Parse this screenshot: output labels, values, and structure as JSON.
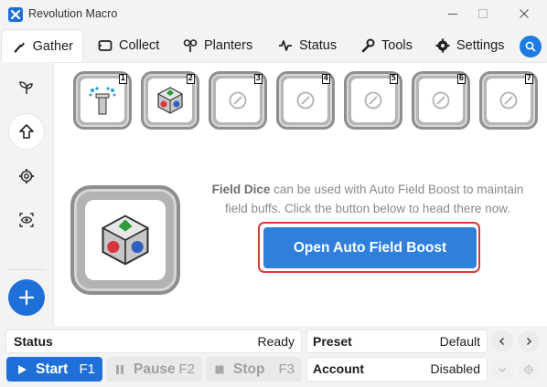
{
  "window": {
    "title": "Revolution Macro",
    "controls": [
      "minimize-icon",
      "maximize-icon",
      "close-icon"
    ]
  },
  "tabs": [
    {
      "label": "Gather",
      "icon": "gather-icon",
      "active": true
    },
    {
      "label": "Collect",
      "icon": "ticket-icon",
      "active": false
    },
    {
      "label": "Planters",
      "icon": "sprout-icon",
      "active": false
    },
    {
      "label": "Status",
      "icon": "pulse-icon",
      "active": false
    },
    {
      "label": "Tools",
      "icon": "wrench-icon",
      "active": false
    },
    {
      "label": "Settings",
      "icon": "gear-icon",
      "active": false
    }
  ],
  "sidebar": {
    "items": [
      {
        "icon": "sprout-icon",
        "active": false
      },
      {
        "icon": "arrow-up-icon",
        "active": true
      },
      {
        "icon": "gear-icon",
        "active": false
      },
      {
        "icon": "eye-scan-icon",
        "active": false
      }
    ],
    "add_icon": "plus-icon"
  },
  "slots": [
    {
      "number": "1",
      "icon": "sprinkler-icon"
    },
    {
      "number": "2",
      "icon": "field-dice-icon"
    },
    {
      "number": "3",
      "icon": "empty-slot-icon"
    },
    {
      "number": "4",
      "icon": "empty-slot-icon"
    },
    {
      "number": "5",
      "icon": "empty-slot-icon"
    },
    {
      "number": "6",
      "icon": "empty-slot-icon"
    },
    {
      "number": "7",
      "icon": "empty-slot-icon"
    }
  ],
  "main": {
    "selected_item_icon": "field-dice-icon",
    "desc_highlight": "Field Dice",
    "desc_rest": " can be used with Auto Field Boost to maintain field buffs. Click the button below to head there now.",
    "boost_button": "Open Auto Field Boost"
  },
  "status": {
    "label": "Status",
    "value": "Ready"
  },
  "preset": {
    "label": "Preset",
    "value": "Default"
  },
  "account": {
    "label": "Account",
    "value": "Disabled"
  },
  "controls": {
    "start": {
      "label": "Start",
      "key": "F1"
    },
    "pause": {
      "label": "Pause",
      "key": "F2"
    },
    "stop": {
      "label": "Stop",
      "key": "F3"
    }
  },
  "colors": {
    "accent": "#1f6fd8",
    "boost_button": "#2f7fdb",
    "highlight_border": "#d73a3a",
    "muted_text": "#8a8a8a",
    "disabled_text": "#a0a0a0"
  }
}
